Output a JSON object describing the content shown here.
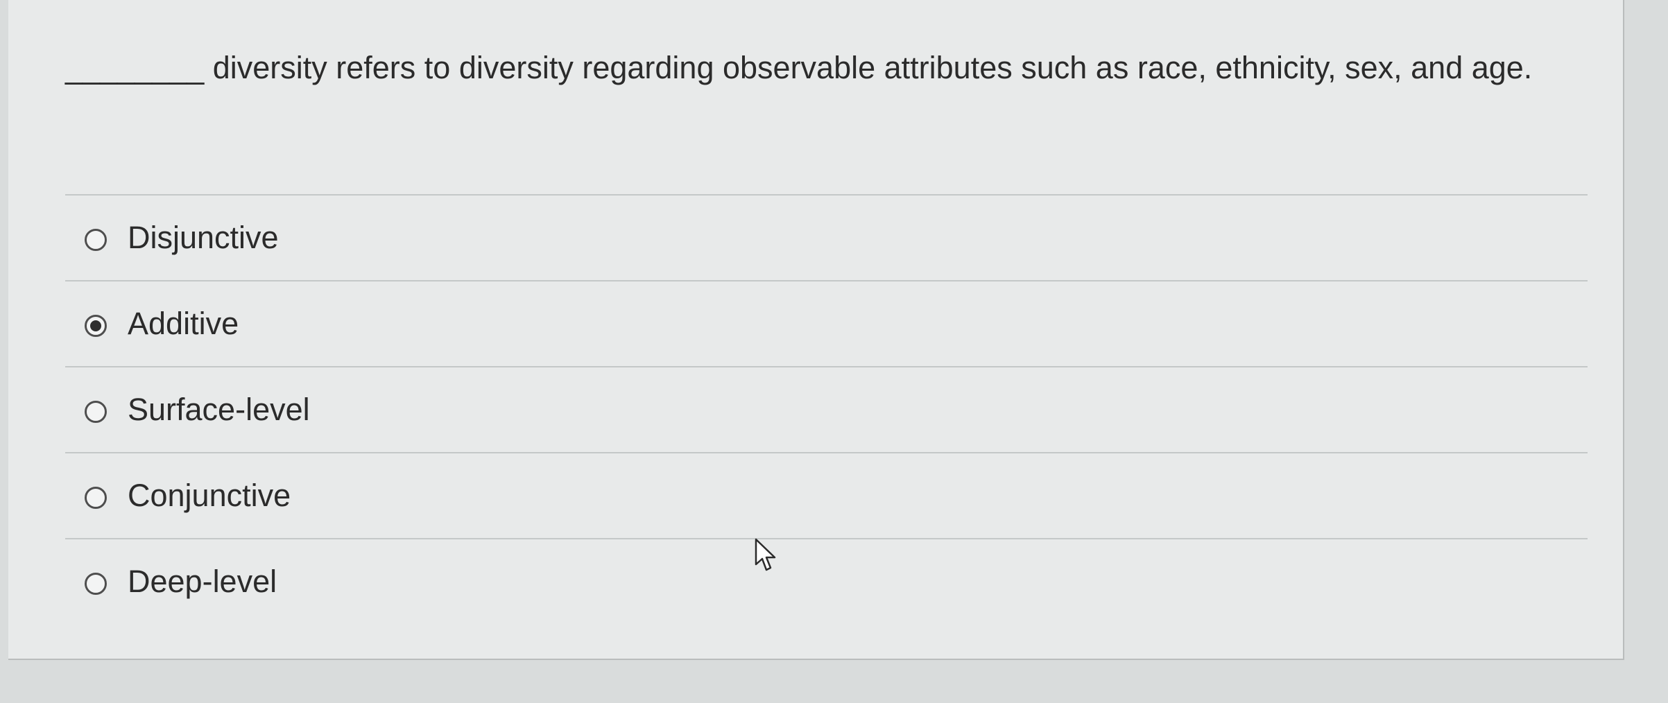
{
  "question": {
    "text": "________ diversity refers to diversity regarding observable attributes such as race, ethnicity, sex, and age."
  },
  "options": [
    {
      "label": "Disjunctive",
      "selected": false
    },
    {
      "label": "Additive",
      "selected": true
    },
    {
      "label": "Surface-level",
      "selected": false
    },
    {
      "label": "Conjunctive",
      "selected": false
    },
    {
      "label": "Deep-level",
      "selected": false
    }
  ],
  "icons": {
    "radio_unselected": "radio-unselected-icon",
    "radio_selected": "radio-selected-icon",
    "cursor": "mouse-pointer-icon"
  },
  "colors": {
    "background": "#d9dcdc",
    "card": "#e8eaea",
    "text": "#2b2b2b",
    "divider": "#c4c8c8"
  }
}
